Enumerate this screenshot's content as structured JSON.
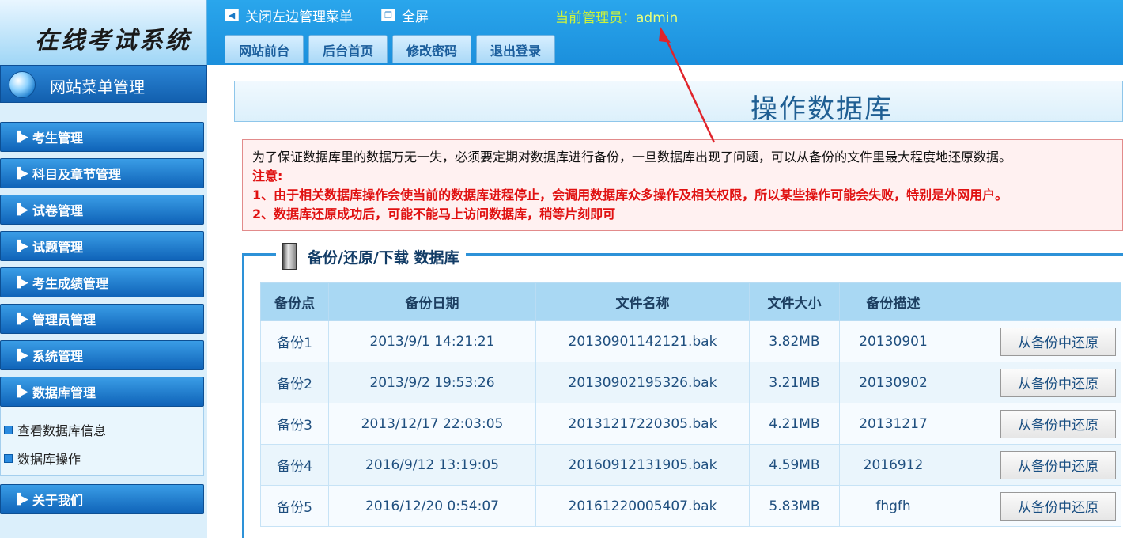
{
  "app": {
    "logo_text": "在线考试系统"
  },
  "topbar": {
    "close_menu_label": "关闭左边管理菜单",
    "fullscreen_label": "全屏",
    "admin_label": "当前管理员：",
    "admin_name": "admin",
    "tabs": [
      {
        "label": "网站前台"
      },
      {
        "label": "后台首页"
      },
      {
        "label": "修改密码"
      },
      {
        "label": "退出登录"
      }
    ]
  },
  "sidebar": {
    "title": "网站菜单管理",
    "items": [
      {
        "label": "考生管理"
      },
      {
        "label": "科目及章节管理"
      },
      {
        "label": "试卷管理"
      },
      {
        "label": "试题管理"
      },
      {
        "label": "考生成绩管理"
      },
      {
        "label": "管理员管理"
      },
      {
        "label": "系统管理"
      },
      {
        "label": "数据库管理"
      },
      {
        "label": "关于我们"
      }
    ],
    "subitems": [
      {
        "label": "查看数据库信息"
      },
      {
        "label": "数据库操作"
      }
    ]
  },
  "main": {
    "page_title": "操作数据库",
    "notice": {
      "line1": "为了保证数据库里的数据万无一失，必须要定期对数据库进行备份，一旦数据库出现了问题，可以从备份的文件里最大程度地还原数据。",
      "note_label": "注意:",
      "note1": "1、由于相关数据库操作会使当前的数据库进程停止，会调用数据库众多操作及相关权限，所以某些操作可能会失败，特别是外网用户。",
      "note2": "2、数据库还原成功后，可能不能马上访问数据库，稍等片刻即可"
    },
    "section_title": "备份/还原/下载 数据库",
    "table": {
      "headers": [
        "备份点",
        "备份日期",
        "文件名称",
        "文件大小",
        "备份描述",
        ""
      ],
      "restore_label": "从备份中还原",
      "rows": [
        {
          "point": "备份1",
          "date": "2013/9/1 14:21:21",
          "file": "20130901142121.bak",
          "size": "3.82MB",
          "desc": "20130901"
        },
        {
          "point": "备份2",
          "date": "2013/9/2 19:53:26",
          "file": "20130902195326.bak",
          "size": "3.21MB",
          "desc": "20130902"
        },
        {
          "point": "备份3",
          "date": "2013/12/17 22:03:05",
          "file": "20131217220305.bak",
          "size": "4.21MB",
          "desc": "20131217"
        },
        {
          "point": "备份4",
          "date": "2016/9/12 13:19:05",
          "file": "20160912131905.bak",
          "size": "4.59MB",
          "desc": "2016912"
        },
        {
          "point": "备份5",
          "date": "2016/12/20 0:54:07",
          "file": "20161220005407.bak",
          "size": "5.83MB",
          "desc": "fhgfh"
        }
      ]
    }
  },
  "colors": {
    "topbar": "#1b8fdc",
    "admin_text": "#cdf23a",
    "notice_red": "#e01111",
    "annotation_arrow": "#e0242b"
  },
  "icons": {
    "close_menu": "left-triangle-icon",
    "fullscreen": "fullscreen-icon",
    "sidebar_head": "globe-icon",
    "menu_item": "play-arrow-icon",
    "submenu": "square-bullet-icon",
    "section": "database-icon"
  }
}
